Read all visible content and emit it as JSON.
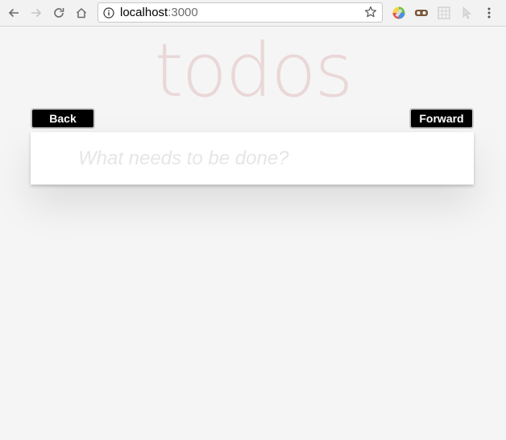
{
  "browser": {
    "url_host": "localhost",
    "url_port": ":3000",
    "icons": {
      "back": "arrow-left-icon",
      "forward": "arrow-right-icon",
      "reload": "reload-icon",
      "home": "home-icon",
      "info": "info-icon",
      "bookmark": "star-icon",
      "extensions": [
        "color-picker-extension-icon",
        "mask-extension-icon",
        "grid-extension-icon",
        "cursor-extension-icon"
      ],
      "menu": "kebab-menu-icon"
    }
  },
  "app": {
    "title": "todos",
    "back_label": "Back",
    "forward_label": "Forward",
    "new_todo_placeholder": "What needs to be done?",
    "colors": {
      "title": "#eddcdc",
      "button_bg": "#000000",
      "background": "#f5f5f5"
    }
  }
}
